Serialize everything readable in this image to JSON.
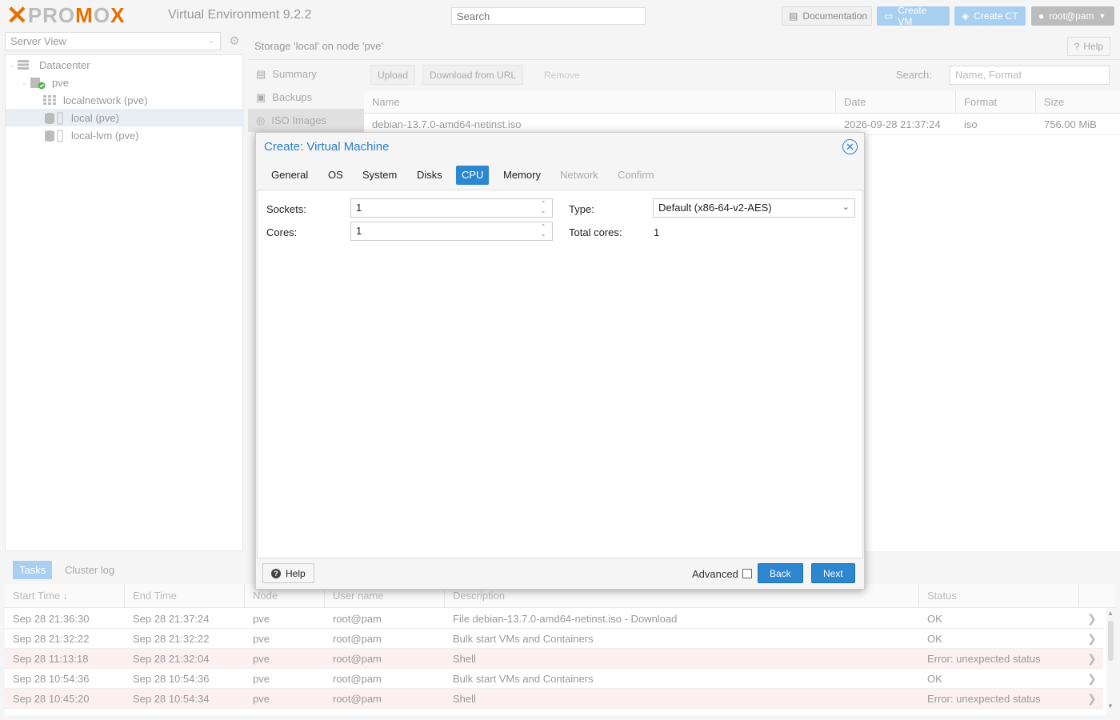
{
  "header": {
    "logo_text_1": "PRO",
    "logo_text_2": "M",
    "logo_text_3": "O",
    "logo_text_4": "X",
    "version": "Virtual Environment 9.2.2",
    "search_placeholder": "Search",
    "documentation_label": "Documentation",
    "create_vm_label": "Create VM",
    "create_ct_label": "Create CT",
    "user_label": "root@pam"
  },
  "sidebar": {
    "view_select": "Server View",
    "tree": [
      {
        "label": "Datacenter"
      },
      {
        "label": "pve"
      },
      {
        "label": "localnetwork (pve)"
      },
      {
        "label": "local (pve)"
      },
      {
        "label": "local-lvm (pve)"
      }
    ]
  },
  "panel": {
    "title": "Storage 'local' on node 'pve'",
    "help_label": "Help",
    "subnav": [
      {
        "label": "Summary"
      },
      {
        "label": "Backups"
      },
      {
        "label": "ISO Images"
      }
    ],
    "toolbar": {
      "upload": "Upload",
      "download": "Download from URL",
      "remove": "Remove",
      "search_label": "Search:",
      "search_placeholder": "Name, Format"
    },
    "columns": [
      "Name",
      "Date",
      "Format",
      "Size"
    ],
    "rows": [
      {
        "name": "debian-13.7.0-amd64-netinst.iso",
        "date": "2026-09-28 21:37:24",
        "format": "iso",
        "size": "756.00 MiB"
      }
    ]
  },
  "modal": {
    "title": "Create: Virtual Machine",
    "tabs": [
      {
        "label": "General"
      },
      {
        "label": "OS"
      },
      {
        "label": "System"
      },
      {
        "label": "Disks"
      },
      {
        "label": "CPU"
      },
      {
        "label": "Memory"
      },
      {
        "label": "Network"
      },
      {
        "label": "Confirm"
      }
    ],
    "active_tab": "CPU",
    "fields": {
      "sockets_label": "Sockets:",
      "sockets_value": "1",
      "cores_label": "Cores:",
      "cores_value": "1",
      "type_label": "Type:",
      "type_value": "Default (x86-64-v2-AES)",
      "total_cores_label": "Total cores:",
      "total_cores_value": "1"
    },
    "footer": {
      "help": "Help",
      "advanced": "Advanced",
      "back": "Back",
      "next": "Next"
    }
  },
  "tasks": {
    "tabs": [
      "Tasks",
      "Cluster log"
    ],
    "columns": [
      "Start Time",
      "End Time",
      "Node",
      "User name",
      "Description",
      "Status"
    ],
    "rows": [
      {
        "start": "Sep 28 21:36:30",
        "end": "Sep 28 21:37:24",
        "node": "pve",
        "user": "root@pam",
        "desc": "File debian-13.7.0-amd64-netinst.iso - Download",
        "status": "OK"
      },
      {
        "start": "Sep 28 21:32:22",
        "end": "Sep 28 21:32:22",
        "node": "pve",
        "user": "root@pam",
        "desc": "Bulk start VMs and Containers",
        "status": "OK"
      },
      {
        "start": "Sep 28 11:13:18",
        "end": "Sep 28 21:32:04",
        "node": "pve",
        "user": "root@pam",
        "desc": "Shell",
        "status": "Error: unexpected status"
      },
      {
        "start": "Sep 28 10:54:36",
        "end": "Sep 28 10:54:36",
        "node": "pve",
        "user": "root@pam",
        "desc": "Bulk start VMs and Containers",
        "status": "OK"
      },
      {
        "start": "Sep 28 10:45:20",
        "end": "Sep 28 10:54:34",
        "node": "pve",
        "user": "root@pam",
        "desc": "Shell",
        "status": "Error: unexpected status"
      }
    ]
  },
  "colors": {
    "accent": "#2c86d0",
    "logo_orange": "#e57000",
    "error_row": "#fcf0f0"
  }
}
